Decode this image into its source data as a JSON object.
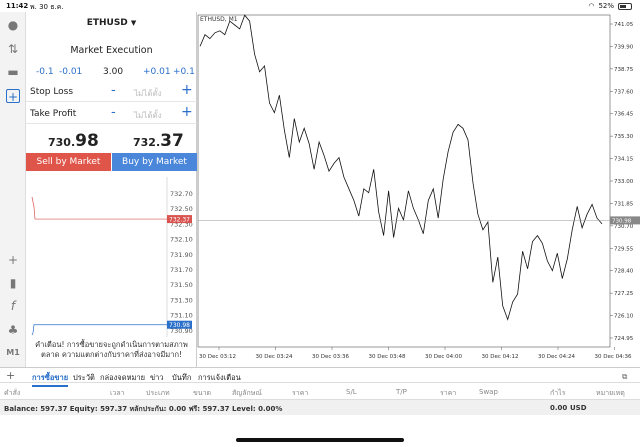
{
  "status_bar": {
    "time": "11:42",
    "date": "พ. 30 ธ.ค.",
    "battery": "52%"
  },
  "symbol": "ETHUSD",
  "execution": "Market Execution",
  "lots": {
    "minus2": "-0.1",
    "minus1": "-0.01",
    "value": "3.00",
    "plus1": "+0.01",
    "plus2": "+0.1"
  },
  "stop_loss": {
    "label": "Stop Loss",
    "placeholder": "ไม่ได้ตั้ง",
    "minus": "-",
    "plus": "+"
  },
  "take_profit": {
    "label": "Take Profit",
    "placeholder": "ไม่ได้ตั้ง",
    "minus": "-",
    "plus": "+"
  },
  "bid": {
    "prefix": "730.",
    "big": "98"
  },
  "ask": {
    "prefix": "732.",
    "big": "37"
  },
  "sell_label": "Sell by Market",
  "buy_label": "Buy by Market",
  "mini_axis": [
    "732.70",
    "732.50",
    "732.30",
    "732.10",
    "731.90",
    "731.70",
    "731.50",
    "731.30",
    "731.10",
    "730.90"
  ],
  "mini_ask_tag": "732.37",
  "mini_bid_tag": "730.98",
  "warning": "คำเตือน! การซื้อขายจะถูกดำเนินการตามสภาพตลาด ความแตกต่างกับราคาที่ส่งอาจมีมาก!",
  "timeframe": "M1",
  "chart_title": "ETHUSD, M1",
  "chart_data": {
    "type": "line",
    "y_ticks": [
      "741.05",
      "739.90",
      "738.75",
      "737.60",
      "736.45",
      "735.30",
      "734.15",
      "733.00",
      "731.85",
      "730.70",
      "729.55",
      "728.40",
      "727.25",
      "726.10",
      "724.95"
    ],
    "x_ticks": [
      "30 Dec 03:12",
      "30 Dec 03:24",
      "30 Dec 03:36",
      "30 Dec 03:48",
      "30 Dec 04:00",
      "30 Dec 04:12",
      "30 Dec 04:24",
      "30 Dec 04:36"
    ],
    "ylim": [
      724.95,
      741.05
    ],
    "current_price": "730.98",
    "values": [
      739.9,
      740.5,
      740.3,
      740.6,
      740.7,
      740.5,
      741.2,
      741.0,
      740.8,
      741.5,
      741.2,
      739.5,
      738.6,
      738.9,
      737.0,
      736.5,
      737.4,
      735.6,
      734.2,
      736.2,
      735.0,
      735.7,
      734.9,
      733.6,
      735.0,
      734.3,
      733.5,
      733.9,
      734.2,
      733.2,
      732.6,
      732.0,
      731.2,
      732.6,
      732.4,
      733.6,
      731.4,
      730.2,
      732.5,
      730.1,
      731.6,
      731.0,
      732.5,
      731.6,
      731.0,
      730.3,
      732.0,
      732.6,
      731.1,
      733.1,
      734.5,
      735.5,
      735.9,
      735.7,
      735.1,
      732.9,
      731.3,
      730.5,
      730.9,
      727.8,
      729.1,
      726.6,
      725.9,
      726.8,
      727.2,
      729.4,
      728.5,
      729.9,
      730.2,
      729.8,
      728.9,
      728.4,
      729.3,
      728.0,
      729.0,
      730.5,
      731.7,
      730.6,
      731.3,
      731.8,
      731.1,
      730.8
    ]
  },
  "tabs": [
    "การซื้อขาย",
    "ประวัติ",
    "กล่องจดหมาย",
    "ข่าว",
    "บันทึก",
    "การแจ้งเตือน"
  ],
  "columns": [
    "คำสั่ง",
    "เวลา",
    "ประเภท",
    "ขนาด",
    "สัญลักษณ์",
    "ราคา",
    "S/L",
    "T/P",
    "ราคา",
    "Swap",
    "กำไร",
    "หมายเหตุ"
  ],
  "balance_line": "Balance: 597.37 Equity: 597.37 หลักประกัน: 0.00 ฟรี: 597.37 Level: 0.00%",
  "profit_total": "0.00",
  "currency": "USD"
}
